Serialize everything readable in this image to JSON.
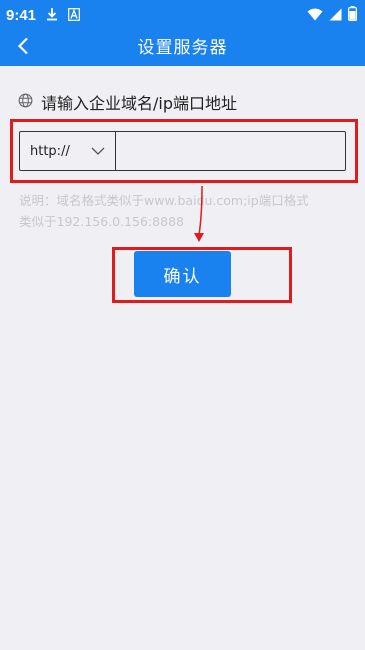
{
  "status_bar": {
    "time": "9:41"
  },
  "app_bar": {
    "title": "设置服务器"
  },
  "form": {
    "label": "请输入企业域名/ip端口地址",
    "protocol_selected": "http://",
    "input_value": "",
    "input_placeholder": "",
    "hint_line1": "说明：域名格式类似于www.baidu.com;ip端口格式",
    "hint_line2": "类似于192.156.0.156:8888",
    "confirm_label": "确认"
  },
  "colors": {
    "primary": "#1a82ee",
    "highlight": "#e11b1b",
    "background": "#f0f0f4",
    "hint": "#c7c7cc"
  },
  "icons": {
    "status": [
      "download-icon",
      "font-a-icon",
      "wifi-icon",
      "signal-icon",
      "battery-icon"
    ],
    "back": "chevron-left-icon",
    "label": "globe-icon",
    "dropdown": "chevron-down-icon"
  }
}
